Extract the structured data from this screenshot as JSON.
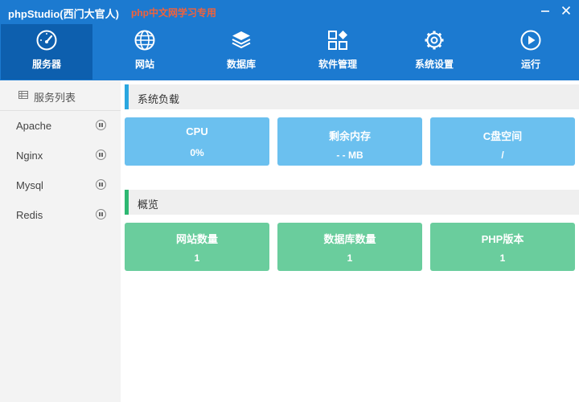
{
  "window": {
    "title": "phpStudio(西门大官人)",
    "subtitle": "php中文网学习专用"
  },
  "nav": [
    {
      "label": "服务器",
      "icon": "gauge-icon",
      "active": true
    },
    {
      "label": "网站",
      "icon": "globe-icon"
    },
    {
      "label": "数据库",
      "icon": "database-layers-icon"
    },
    {
      "label": "软件管理",
      "icon": "apps-grid-icon"
    },
    {
      "label": "系统设置",
      "icon": "gear-icon"
    },
    {
      "label": "运行",
      "icon": "play-circle-icon"
    }
  ],
  "sidebar": {
    "header": "服务列表",
    "services": [
      {
        "name": "Apache"
      },
      {
        "name": "Nginx"
      },
      {
        "name": "Mysql"
      },
      {
        "name": "Redis"
      }
    ]
  },
  "load": {
    "title": "系统负载",
    "cards": [
      {
        "label": "CPU",
        "value": "0%"
      },
      {
        "label": "剩余内存",
        "value": "- - MB"
      },
      {
        "label": "C盘空间",
        "value": "/"
      }
    ]
  },
  "overview": {
    "title": "概览",
    "cards": [
      {
        "label": "网站数量",
        "value": "1"
      },
      {
        "label": "数据库数量",
        "value": "1"
      },
      {
        "label": "PHP版本",
        "value": "1"
      }
    ]
  },
  "colors": {
    "header": "#1c7ad0",
    "nav_active": "#0d5fae",
    "subtitle": "#f2613a",
    "load_accent": "#2aa7e0",
    "overview_accent": "#2eb872",
    "load_card": "#6bc0ef",
    "overview_card": "#6acd9d"
  }
}
